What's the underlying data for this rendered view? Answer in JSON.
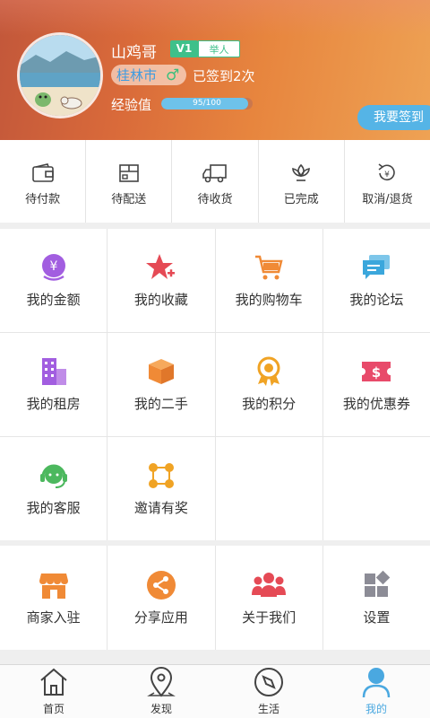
{
  "profile": {
    "username": "山鸡哥",
    "vip_level": "V1",
    "rank": "举人",
    "city": "桂林市",
    "gender_symbol": "♂",
    "signed_text": "已签到2次",
    "exp_label": "经验值",
    "exp_text": "95/100",
    "exp_fraction": 0.95,
    "signin_button": "我要签到"
  },
  "orders": [
    {
      "label": "待付款",
      "icon": "wallet-icon"
    },
    {
      "label": "待配送",
      "icon": "package-icon"
    },
    {
      "label": "待收货",
      "icon": "truck-icon"
    },
    {
      "label": "已完成",
      "icon": "lotus-icon"
    },
    {
      "label": "取消/退货",
      "icon": "refund-icon"
    }
  ],
  "menu": [
    {
      "label": "我的金额",
      "icon": "money-icon",
      "color": "#a25ee0"
    },
    {
      "label": "我的收藏",
      "icon": "star-plus-icon",
      "color": "#e54a55"
    },
    {
      "label": "我的购物车",
      "icon": "cart-icon",
      "color": "#f08a36"
    },
    {
      "label": "我的论坛",
      "icon": "chat-icon",
      "color": "#3ba7dc"
    },
    {
      "label": "我的租房",
      "icon": "building-icon",
      "color": "#a25ee0"
    },
    {
      "label": "我的二手",
      "icon": "box-icon",
      "color": "#f08a36"
    },
    {
      "label": "我的积分",
      "icon": "medal-icon",
      "color": "#f0a324"
    },
    {
      "label": "我的优惠券",
      "icon": "coupon-icon",
      "color": "#e84a6a"
    },
    {
      "label": "我的客服",
      "icon": "headset-icon",
      "color": "#4cb85e"
    },
    {
      "label": "邀请有奖",
      "icon": "invite-icon",
      "color": "#f0a324"
    }
  ],
  "extras": [
    {
      "label": "商家入驻",
      "icon": "shop-icon",
      "color": "#f08a36"
    },
    {
      "label": "分享应用",
      "icon": "share-icon",
      "color": "#f08a36"
    },
    {
      "label": "关于我们",
      "icon": "group-icon",
      "color": "#e54a55"
    },
    {
      "label": "设置",
      "icon": "settings-icon",
      "color": "#8c8c96"
    }
  ],
  "tabs": [
    {
      "label": "首页",
      "icon": "home-icon",
      "active": false
    },
    {
      "label": "发现",
      "icon": "location-icon",
      "active": false
    },
    {
      "label": "生活",
      "icon": "compass-icon",
      "active": false
    },
    {
      "label": "我的",
      "icon": "user-icon",
      "active": true
    }
  ]
}
